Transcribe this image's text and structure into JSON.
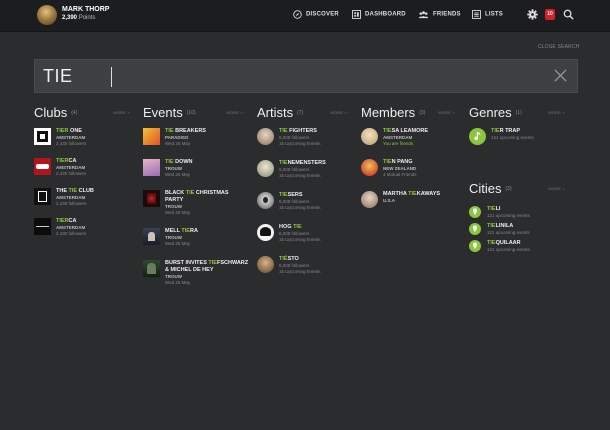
{
  "user": {
    "name": "MARK THORP",
    "points_value": "2,390",
    "points_label": "Points"
  },
  "nav": {
    "discover": "DISCOVER",
    "dashboard": "DASHBOARD",
    "friends": "FRIENDS",
    "lists": "LISTS"
  },
  "notifications": {
    "count": "10"
  },
  "search": {
    "close_label": "CLOSE SEARCH",
    "query": "TIE"
  },
  "columns": {
    "clubs": {
      "title": "Clubs",
      "count": "(4)",
      "more": "MORE >",
      "items": [
        {
          "hl": "TIER",
          "rest": " ONE",
          "sub": "AMSTERDAM",
          "meta": "2,430 followers"
        },
        {
          "hl": "TIER",
          "rest": "CA",
          "sub": "AMSTERDAM",
          "meta": "2,430 followers"
        },
        {
          "pre": "THE ",
          "hl": "TIE",
          "rest": " CLUB",
          "sub": "AMSTERDAM",
          "meta": "2,430 followers"
        },
        {
          "hl": "TIER",
          "rest": "CA",
          "sub": "AMSTERDAM",
          "meta": "2,430 followers"
        }
      ]
    },
    "events": {
      "title": "Events",
      "count": "(10)",
      "more": "MORE >",
      "items": [
        {
          "hl": "TIE",
          "rest": " BREAKERS",
          "sub": "PARADISO",
          "meta": "Wed 25 May"
        },
        {
          "hl": "TIE",
          "rest": " DOWN",
          "sub": "TROUW",
          "meta": "Wed 25 May"
        },
        {
          "pre": "BLACK ",
          "hl": "TIE",
          "rest": " CHRISTMAS",
          "line2": "PARTY",
          "sub": "TROUW",
          "meta": "Wed 25 May"
        },
        {
          "pre": "MELL ",
          "hl": "TIE",
          "rest": "RA",
          "sub": "TROUW",
          "meta": "Wed 25 May"
        },
        {
          "pre": "BURST INVITES ",
          "hl": "TIE",
          "rest": "FSCHWARZ",
          "line2": "& MICHEL DE HEY",
          "sub": "TROUW",
          "meta": "Wed 25 May"
        }
      ]
    },
    "artists": {
      "title": "Artists",
      "count": "(7)",
      "more": "MORE >",
      "items": [
        {
          "hl": "TIE",
          "rest": " FIGHTERS",
          "sub": "5,209 followers",
          "meta": "15 Upcoming Events"
        },
        {
          "hl": "TIE",
          "rest": "NEMENSTERS",
          "sub": "5,209 followers",
          "meta": "15 Upcoming Events"
        },
        {
          "hl": "TIE",
          "rest": "SERS",
          "sub": "5,209 followers",
          "meta": "15 Upcoming Events"
        },
        {
          "pre": "HOG ",
          "hl": "TIE",
          "rest": "",
          "sub": "5,209 followers",
          "meta": "15 Upcoming Events"
        },
        {
          "hl": "TIË",
          "rest": "STO",
          "sub": "5,209 followers",
          "meta": "15 Upcoming Events"
        }
      ]
    },
    "members": {
      "title": "Members",
      "count": "(3)",
      "more": "MORE >",
      "items": [
        {
          "hl": "TIE",
          "rest": "SA LEAMORE",
          "sub": "AMSTERDAM",
          "meta": "You are friends",
          "meta_green": true
        },
        {
          "hl": "TIE",
          "rest": "N PANG",
          "sub": "NEW ZEALAND",
          "meta": "4 Mutual Friends"
        },
        {
          "pre": "MARTHA ",
          "hl": "TIE",
          "rest": "KAWAYS",
          "sub": "U.S.A",
          "meta": ""
        }
      ]
    },
    "genres": {
      "title": "Genres",
      "count": "(1)",
      "more": "MORE >",
      "items": [
        {
          "hl": "TIE",
          "rest": "R TRAP",
          "meta": "121 upcoming events"
        }
      ]
    },
    "cities": {
      "title": "Cities",
      "count": "(3)",
      "more": "MORE >",
      "items": [
        {
          "hl": "TIE",
          "rest": "LI",
          "meta": "121 upcoming events"
        },
        {
          "hl": "TIE",
          "rest": "LINILA",
          "meta": "121 upcoming events"
        },
        {
          "hl": "TIE",
          "rest": "QUILAAR",
          "meta": "121 upcoming events"
        }
      ]
    }
  }
}
